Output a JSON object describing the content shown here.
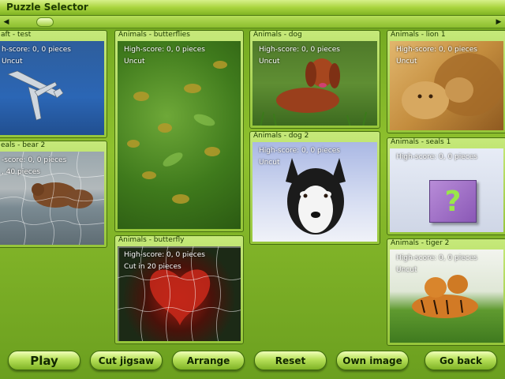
{
  "window": {
    "title": "Puzzle Selector"
  },
  "scroll": {
    "left_icon": "arrow-left-icon",
    "right_icon": "arrow-right-icon"
  },
  "puzzles": [
    {
      "header": "aft - test",
      "score": "h-score: 0, 0 pieces",
      "state": "Uncut"
    },
    {
      "header": "Animals - butterflies",
      "score": "High-score: 0, 0 pieces",
      "state": "Uncut"
    },
    {
      "header": "Animals - dog",
      "score": "High-score: 0, 0 pieces",
      "state": "Uncut"
    },
    {
      "header": "Animals - lion 1",
      "score": "High-score: 0, 0 pieces",
      "state": "Uncut"
    },
    {
      "header": "eals - bear 2",
      "score": "-score: 0, 0 pieces",
      "state": ", 40 pieces"
    },
    {
      "header": "Animals - dog 2",
      "score": "High-score: 0, 0 pieces",
      "state": "Uncut"
    },
    {
      "header": "Animals - seals 1",
      "score": "High-score: 0, 0 pieces",
      "state": "",
      "placeholder": "?"
    },
    {
      "header": "Animals - butterfly",
      "score": "High-score: 0, 0 pieces",
      "state": "Cut in 20 pieces"
    },
    {
      "header": "Animals - tiger 2",
      "score": "High-score: 0, 0 pieces",
      "state": "Uncut"
    }
  ],
  "buttons": {
    "play": "Play",
    "cut": "Cut jigsaw",
    "arrange": "Arrange",
    "reset": "Reset",
    "own": "Own image",
    "back": "Go back"
  }
}
